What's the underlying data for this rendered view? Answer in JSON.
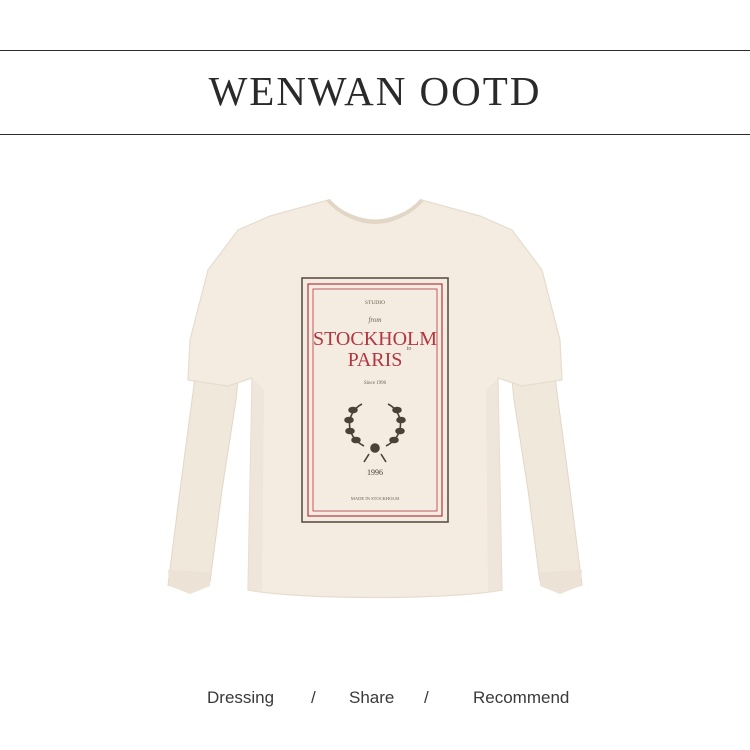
{
  "header": {
    "title": "WENWAN OOTD"
  },
  "product": {
    "image_icon": "cream-layered-long-sleeve-tshirt-image",
    "print": {
      "small_top": "STUDIO",
      "script_from": "from",
      "line1": "STOCKHOLM",
      "script_to": "to",
      "line2": "PARIS",
      "small_mid": "Since 1996",
      "year": "1996",
      "small_bottom": "MADE IN STOCKHOLM"
    },
    "colors": {
      "shirt": "#f4ece1",
      "shirt_shadow": "#e9dfd2",
      "print_red": "#b2353f",
      "print_dark": "#4a4138"
    }
  },
  "nav": {
    "items": [
      {
        "label": "Dressing"
      },
      {
        "label": "Share"
      },
      {
        "label": "Recommend"
      }
    ],
    "separator": "/"
  }
}
